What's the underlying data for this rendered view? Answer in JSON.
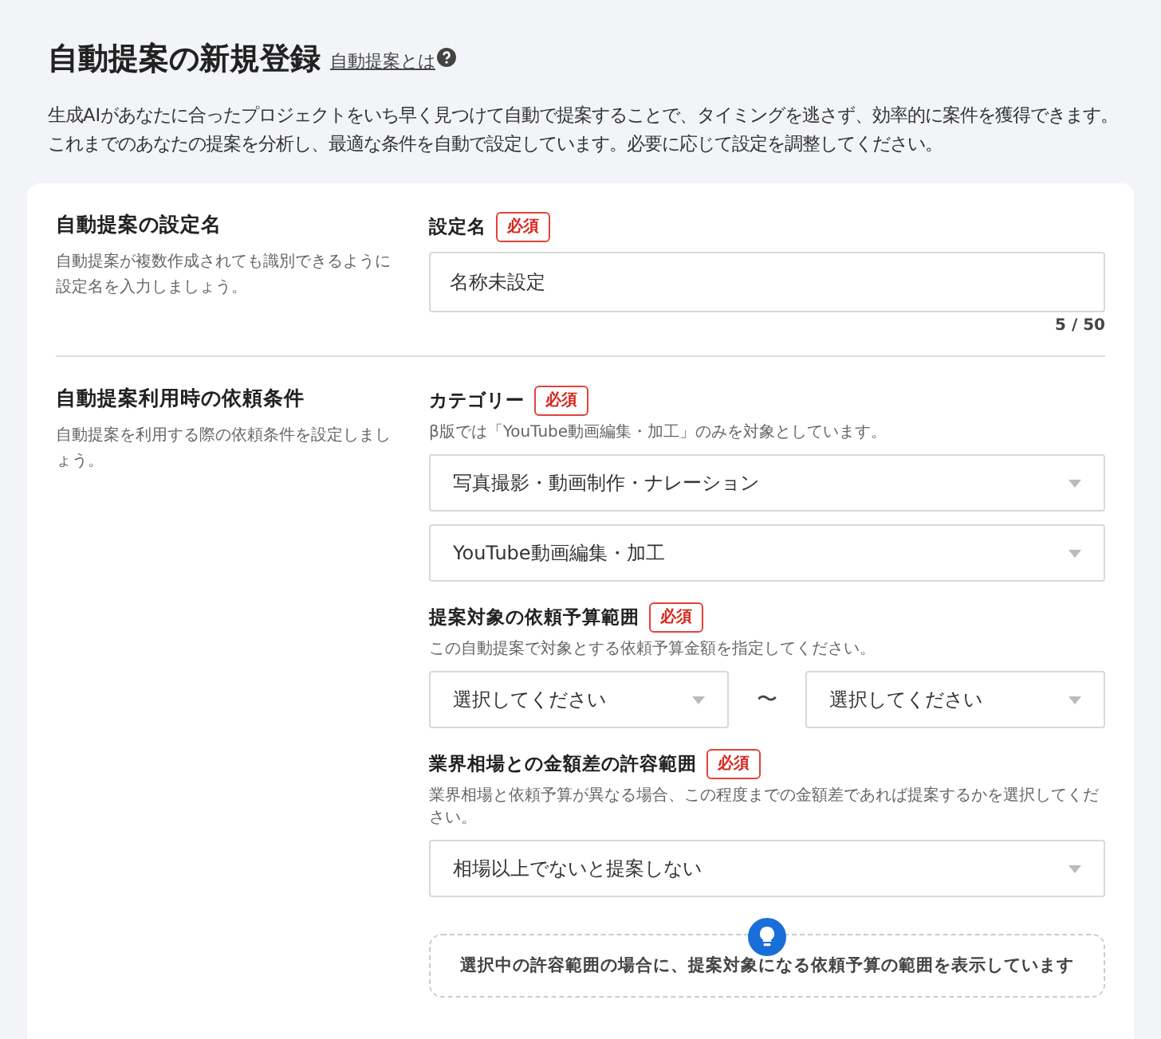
{
  "page": {
    "title": "自動提案の新規登録",
    "help_link": "自動提案とは",
    "description": "生成AIがあなたに合ったプロジェクトをいち早く見つけて自動で提案することで、タイミングを逃さず、効率的に案件を獲得できます。これまでのあなたの提案を分析し、最適な条件を自動で設定しています。必要に応じて設定を調整してください。"
  },
  "sections": [
    {
      "title": "自動提案の設定名",
      "description": "自動提案が複数作成されても識別できるように設定名を入力しましょう。",
      "fields": [
        {
          "kind": "text",
          "label": "設定名",
          "badge": "必須",
          "value": "名称未設定",
          "counter": "5 / 50"
        }
      ]
    },
    {
      "title": "自動提案利用時の依頼条件",
      "description": "自動提案を利用する際の依頼条件を設定しましょう。",
      "fields": [
        {
          "kind": "selects",
          "label": "カテゴリー",
          "badge": "必須",
          "hint": "β版では「YouTube動画編集・加工」のみを対象としています。",
          "selects": [
            "写真撮影・動画制作・ナレーション",
            "YouTube動画編集・加工"
          ]
        },
        {
          "kind": "range",
          "label": "提案対象の依頼予算範囲",
          "badge": "必須",
          "hint": "この自動提案で対象とする依頼予算金額を指定してください。",
          "from": "選択してください",
          "separator": "〜",
          "to": "選択してください"
        },
        {
          "kind": "selects",
          "label": "業界相場との金額差の許容範囲",
          "badge": "必須",
          "hint": "業界相場と依頼予算が異なる場合、この程度までの金額差であれば提案するかを選択してください。",
          "selects": [
            "相場以上でないと提案しない"
          ]
        },
        {
          "kind": "tip",
          "text": "選択中の許容範囲の場合に、提案対象になる依頼予算の範囲を表示しています"
        }
      ]
    }
  ]
}
